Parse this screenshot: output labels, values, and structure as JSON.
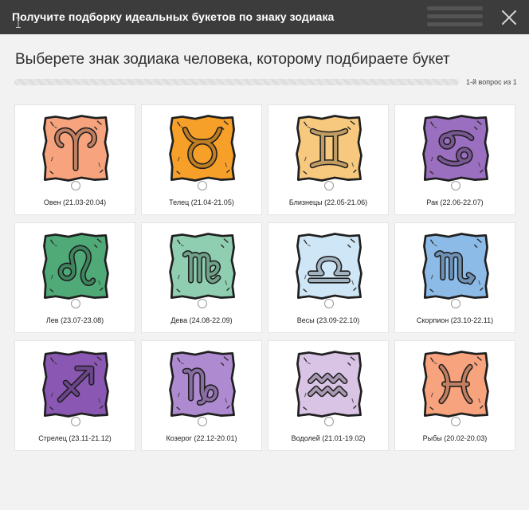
{
  "header": {
    "title": "Получите подборку идеальных букетов по знаку зодиака"
  },
  "quiz": {
    "question": "Выберете знак зодиака человека, которому подбираете букет",
    "progress_label": "1-й вопрос из 1",
    "progress": 0.0
  },
  "signs": [
    {
      "label": "Овен (21.03-20.04)",
      "icon": "aries-icon",
      "color": "#f7a37e"
    },
    {
      "label": "Телец (21.04-21.05)",
      "icon": "taurus-icon",
      "color": "#f6a02a"
    },
    {
      "label": "Близнецы (22.05-21.06)",
      "icon": "gemini-icon",
      "color": "#f7c97f"
    },
    {
      "label": "Рак (22.06-22.07)",
      "icon": "cancer-icon",
      "color": "#9b6fbf"
    },
    {
      "label": "Лев (23.07-23.08)",
      "icon": "leo-icon",
      "color": "#4faa78"
    },
    {
      "label": "Дева (24.08-22.09)",
      "icon": "virgo-icon",
      "color": "#8fceb0"
    },
    {
      "label": "Весы (23.09-22.10)",
      "icon": "libra-icon",
      "color": "#cfe6f6"
    },
    {
      "label": "Скорпион (23.10-22.11)",
      "icon": "scorpio-icon",
      "color": "#8dbbe8"
    },
    {
      "label": "Стрелец (23.11-21.12)",
      "icon": "sagittarius-icon",
      "color": "#8a58b2"
    },
    {
      "label": "Козерог (22.12-20.01)",
      "icon": "capricorn-icon",
      "color": "#ae8ad0"
    },
    {
      "label": "Водолей (21.01-19.02)",
      "icon": "aquarius-icon",
      "color": "#d9c4e6"
    },
    {
      "label": "Рыбы (20.02-20.03)",
      "icon": "pisces-icon",
      "color": "#f7a37e"
    }
  ]
}
